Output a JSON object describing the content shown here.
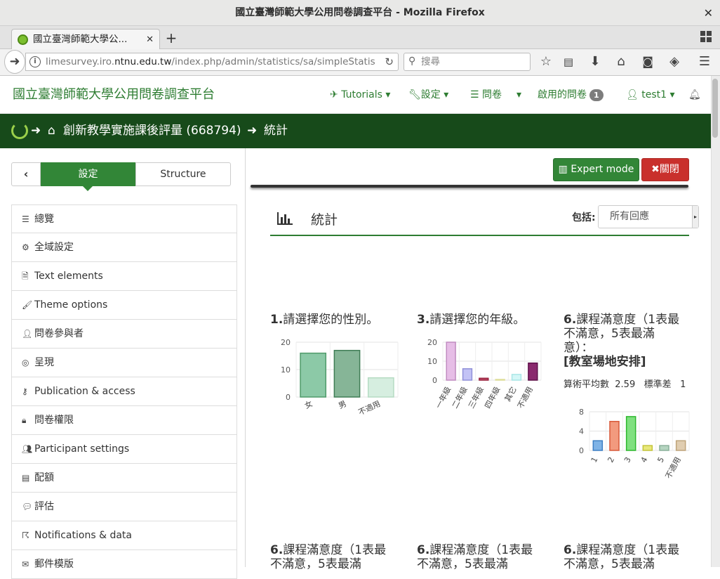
{
  "window": {
    "title": "國立臺灣師範大學公用問卷調查平台 - Mozilla Firefox",
    "close": "✕"
  },
  "tab": {
    "label": "國立臺灣師範大學公...",
    "close": "✕",
    "new_tab": "+"
  },
  "url": {
    "prefix": "limesurvey.iro.",
    "domain": "ntnu.edu.tw",
    "path": "/index.php/admin/statistics/sa/simpleStatis"
  },
  "search": {
    "placeholder": "搜尋"
  },
  "brand": "國立臺灣師範大學公用問卷調查平台",
  "topnav": {
    "tutorials": "Tutorials",
    "settings": "設定",
    "surveys": "問卷",
    "active_surveys": "啟用的問卷",
    "active_count": "1",
    "user": "test1"
  },
  "breadcrumb": {
    "survey": "創新教學實施課後評量 (668794)",
    "page": "統計"
  },
  "sidebar": {
    "settings_label": "設定",
    "structure_label": "Structure",
    "items": [
      {
        "label": "總覽",
        "icon": "list-icon"
      },
      {
        "label": "全域設定",
        "icon": "cogs-icon"
      },
      {
        "label": "Text elements",
        "icon": "file-text-icon"
      },
      {
        "label": "Theme options",
        "icon": "paint-brush-icon"
      },
      {
        "label": "問卷參與者",
        "icon": "user-icon"
      },
      {
        "label": "呈現",
        "icon": "eye-slash-icon"
      },
      {
        "label": "Publication & access",
        "icon": "key-icon"
      },
      {
        "label": "問卷權限",
        "icon": "lock-icon"
      },
      {
        "label": "Participant settings",
        "icon": "users-icon"
      },
      {
        "label": "配額",
        "icon": "tasks-icon"
      },
      {
        "label": "評估",
        "icon": "comment-icon"
      },
      {
        "label": "Notifications & data",
        "icon": "rss-icon"
      },
      {
        "label": "郵件模版",
        "icon": "envelope-icon"
      }
    ]
  },
  "toolbar": {
    "expert_mode": "Expert mode",
    "close": "關閉"
  },
  "stats": {
    "title": "統計",
    "include_label": "包括:",
    "include_value": "所有回應"
  },
  "questions": {
    "q1": {
      "num": "1.",
      "text": "請選擇您的性別。"
    },
    "q3": {
      "num": "3.",
      "text": "請選擇您的年級。"
    },
    "q6a": {
      "num": "6.",
      "line1": "課程滿意度（1表最",
      "line2": "不滿意，5表最滿",
      "line3": "意）：",
      "sub": "[教室場地安排]",
      "mean_label": "算術平均數",
      "mean": "2.59",
      "std_label": "標準差",
      "std": "1"
    },
    "row2": [
      {
        "num": "6.",
        "line1": "課程滿意度（1表最",
        "line2": "不滿意，5表最滿"
      },
      {
        "num": "6.",
        "line1": "課程滿意度（1表最",
        "line2": "不滿意，5表最滿"
      },
      {
        "num": "6.",
        "line1": "課程滿意度（1表最",
        "line2": "不滿意，5表最滿"
      }
    ]
  },
  "chart_data": [
    {
      "type": "bar",
      "categories": [
        "女",
        "男",
        "不適用"
      ],
      "values": [
        16,
        17,
        7
      ],
      "ylim": [
        0,
        20
      ],
      "yticks": [
        0,
        10,
        20
      ],
      "colors": [
        "#8cc9a7",
        "#86b597",
        "#d6eee0"
      ],
      "strokes": [
        "#4f9a6a",
        "#3f7d55",
        "#b5dbc3"
      ]
    },
    {
      "type": "bar",
      "categories": [
        "一年級",
        "二年級",
        "三年級",
        "四年級",
        "其它",
        "不適用"
      ],
      "values": [
        20,
        6,
        1,
        0.3,
        3,
        9
      ],
      "ylim": [
        0,
        20
      ],
      "yticks": [
        0,
        10,
        20
      ],
      "colors": [
        "#e6bde6",
        "#c3c3f5",
        "#c0516d",
        "#f4f4c0",
        "#d4f7f7",
        "#8a2a6e"
      ],
      "strokes": [
        "#c08bc0",
        "#9090d8",
        "#99203c",
        "#dede99",
        "#a9e6e6",
        "#5e1049"
      ]
    },
    {
      "type": "bar",
      "categories": [
        "1",
        "2",
        "3",
        "4",
        "5",
        "不適用"
      ],
      "values": [
        2,
        6,
        7,
        1,
        1,
        2
      ],
      "ylim": [
        0,
        8
      ],
      "yticks": [
        0,
        4,
        8
      ],
      "colors": [
        "#7fb3e6",
        "#f29a7e",
        "#7fe07f",
        "#e8e87a",
        "#b5d4c0",
        "#e0cdb0"
      ],
      "strokes": [
        "#3d7fc4",
        "#d85a3a",
        "#2eb82e",
        "#c4c43a",
        "#8ab09a",
        "#bfa47a"
      ]
    }
  ]
}
